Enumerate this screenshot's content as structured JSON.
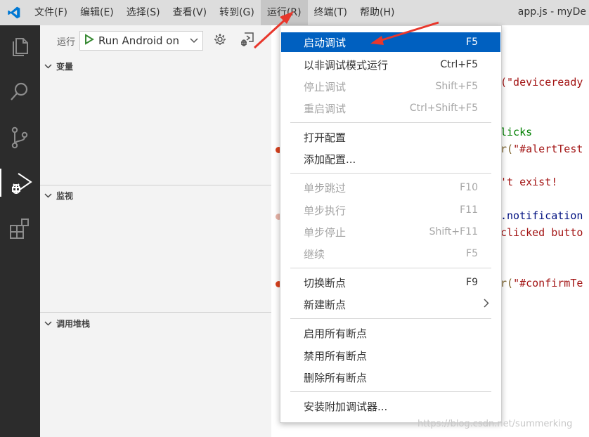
{
  "menubar": {
    "items": [
      "文件(F)",
      "编辑(E)",
      "选择(S)",
      "查看(V)",
      "转到(G)",
      "运行(R)",
      "终端(T)",
      "帮助(H)"
    ],
    "window_title": "app.js - myDe"
  },
  "sidebar": {
    "run_label": "运行",
    "run_config": "Run Android on",
    "sections": {
      "variables": "变量",
      "watch": "监视",
      "call_stack": "调用堆栈"
    }
  },
  "editor": {
    "lines": {
      "l1": "(\"deviceready",
      "l2": "licks",
      "l3a": "r(",
      "l3b": "\"#alertTest",
      "l4": "'t exist!",
      "l5": ".notification",
      "l6": "clicked butto",
      "l7a": "r(",
      "l7b": "\"#confirmTe"
    }
  },
  "run_menu": {
    "start_debugging": {
      "label": "启动调试",
      "shortcut": "F5"
    },
    "run_without_debugging": {
      "label": "以非调试模式运行",
      "shortcut": "Ctrl+F5"
    },
    "stop_debugging": {
      "label": "停止调试",
      "shortcut": "Shift+F5"
    },
    "restart_debugging": {
      "label": "重启调试",
      "shortcut": "Ctrl+Shift+F5"
    },
    "open_configurations": {
      "label": "打开配置"
    },
    "add_configuration": {
      "label": "添加配置..."
    },
    "step_over": {
      "label": "单步跳过",
      "shortcut": "F10"
    },
    "step_into": {
      "label": "单步执行",
      "shortcut": "F11"
    },
    "step_out": {
      "label": "单步停止",
      "shortcut": "Shift+F11"
    },
    "continue": {
      "label": "继续",
      "shortcut": "F5"
    },
    "toggle_breakpoint": {
      "label": "切换断点",
      "shortcut": "F9"
    },
    "new_breakpoint": {
      "label": "新建断点"
    },
    "enable_all_breakpoints": {
      "label": "启用所有断点"
    },
    "disable_all_breakpoints": {
      "label": "禁用所有断点"
    },
    "remove_all_breakpoints": {
      "label": "删除所有断点"
    },
    "install_debuggers": {
      "label": "安装附加调试器..."
    }
  },
  "watermark": "https://blog.csdn.net/summerking",
  "colors": {
    "accent": "#0060c0",
    "activity_bar": "#2c2c2c",
    "string": "#a31515",
    "comment": "#008000",
    "arrow": "#e8372c"
  }
}
